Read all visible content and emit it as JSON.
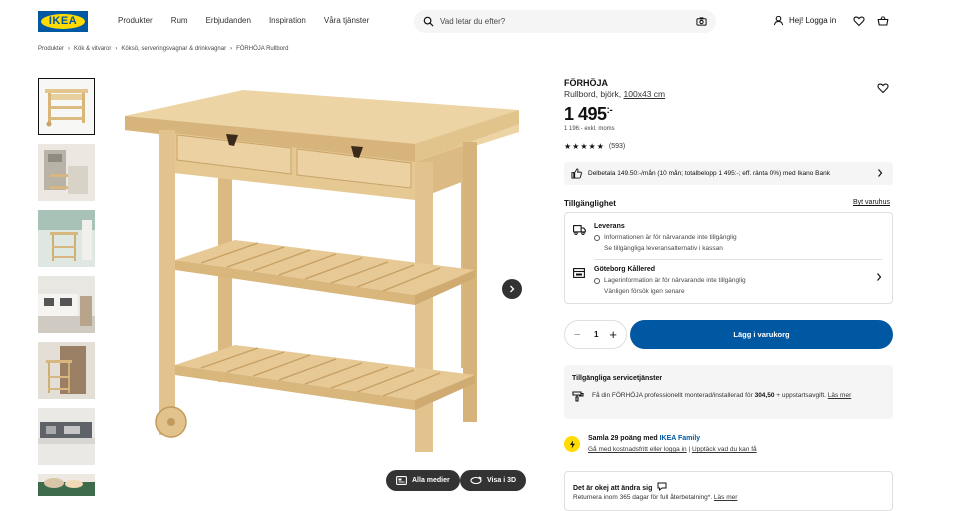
{
  "brand": {
    "logo_text": "IKEA",
    "blue": "#0058a3",
    "yellow": "#ffdb00"
  },
  "nav": {
    "items": [
      "Produkter",
      "Rum",
      "Erbjudanden",
      "Inspiration",
      "Våra tjänster"
    ]
  },
  "search": {
    "placeholder": "Vad letar du efter?"
  },
  "header": {
    "login_label": "Hej! Logga in"
  },
  "breadcrumb": [
    "Produkter",
    "Kök & vitvaror",
    "Köksö, serveringsvagnar & drinkvagnar",
    "FÖRHÖJA Rullbord"
  ],
  "gallery": {
    "all_media_label": "Alla medier",
    "view_3d_label": "Visa i 3D"
  },
  "product": {
    "name": "FÖRHÖJA",
    "desc_prefix": "Rullbord, björk, ",
    "dimension_link": "100x43 cm",
    "price_main": "1 495",
    "price_suffix": ":-",
    "price_ex_vat": "1 196:- exkl. moms",
    "rating_stars": 4.5,
    "rating_count": "(593)"
  },
  "finance": {
    "text": "Delbetala 149.50:-/mån (10 mån; totalbelopp 1 495:-; eff. ränta 0%) med Ikano Bank"
  },
  "availability": {
    "title": "Tillgänglighet",
    "change_store": "Byt varuhus",
    "delivery": {
      "title": "Leverans",
      "line1": "Informationen är för närvarande inte tillgänglig",
      "line2": "Se tillgängliga leveransalternativ i kassan"
    },
    "store": {
      "title": "Göteborg Kållered",
      "line1": "Lagerinformation är för närvarande inte tillgänglig",
      "line2": "Vänligen försök igen senare"
    }
  },
  "cart": {
    "quantity": "1",
    "minus": "−",
    "plus": "+",
    "add_label": "Lägg i varukorg"
  },
  "services": {
    "title": "Tillgängliga servicetjänster",
    "text_prefix": "Få din FÖRHÖJA professionellt monterad/installerad för ",
    "amount": "304,50",
    "text_suffix": " + uppstartsavgift. ",
    "link": "Läs mer"
  },
  "family": {
    "title_prefix": "Samla 29 poäng med ",
    "title_brand": "IKEA Family",
    "link1": "Gå med kostnadsfritt eller logga in",
    "sep": " | ",
    "link2": "Upptäck vad du kan få"
  },
  "returns": {
    "title": "Det är okej att ändra sig",
    "text": "Returnera inom 365 dagar för full återbetalning*. ",
    "link": "Läs mer"
  }
}
